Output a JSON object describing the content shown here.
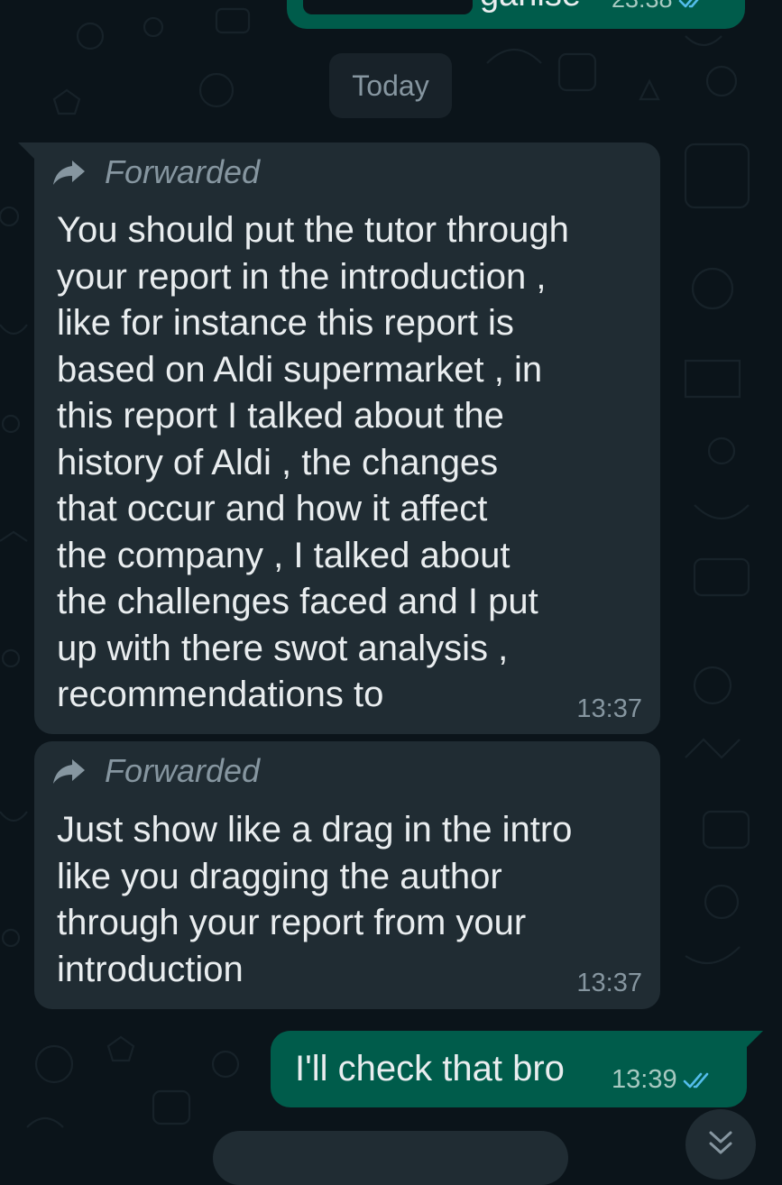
{
  "date_separator": "Today",
  "top_partial_message": {
    "partial_text": "ganise",
    "time": "23:38",
    "status": "read"
  },
  "messages": [
    {
      "direction": "incoming",
      "forwarded_label": "Forwarded",
      "lines": [
        "You should put the tutor through",
        "your report in the introduction ,",
        "like for instance this report is",
        "based on Aldi supermarket , in",
        "this report I talked about the",
        "history of Aldi , the changes",
        "that occur and how it affect",
        "the company , I talked about",
        "the challenges faced and I put",
        "up with there swot analysis ,",
        "recommendations to"
      ],
      "time": "13:37"
    },
    {
      "direction": "incoming",
      "forwarded_label": "Forwarded",
      "lines": [
        "Just show like a drag in the intro",
        "like you dragging the author",
        "through your report from your",
        "introduction"
      ],
      "time": "13:37"
    },
    {
      "direction": "outgoing",
      "text": "I'll check that bro",
      "time": "13:39",
      "status": "read"
    }
  ],
  "icons": {
    "forward": "forward-arrow-icon",
    "read_receipt": "double-check-icon",
    "scroll_down": "double-chevron-down-icon"
  },
  "colors": {
    "background": "#0b141a",
    "incoming_bubble": "#202c33",
    "outgoing_bubble": "#005c4b",
    "text": "#e9edef",
    "meta": "#8696a0",
    "read_tick": "#53bdeb"
  }
}
